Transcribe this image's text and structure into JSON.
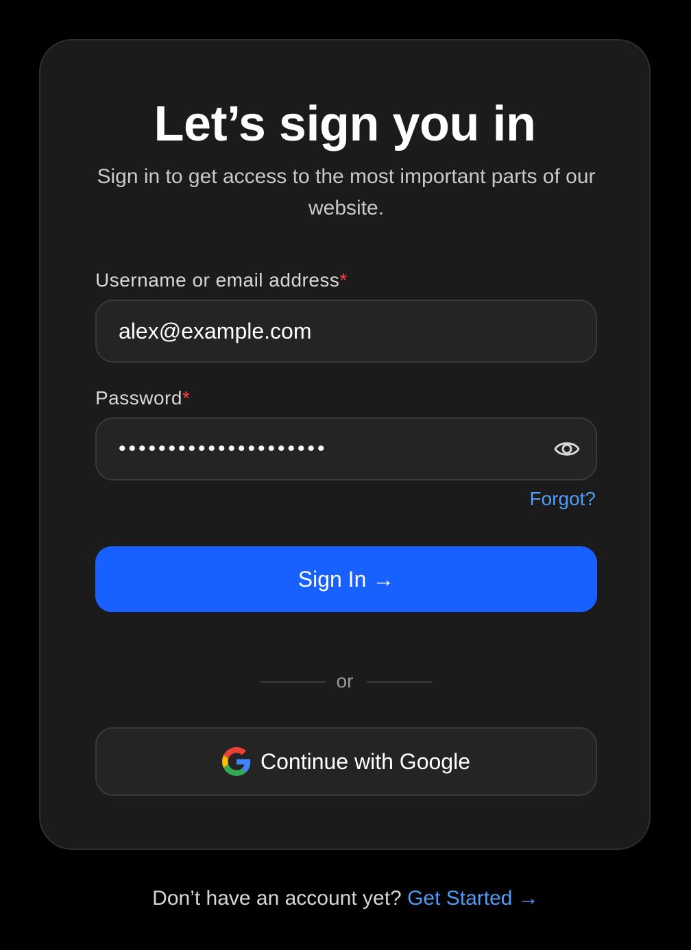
{
  "login": {
    "title": "Let’s sign you in",
    "subtitle": "Sign in to get access to the most important parts of our website.",
    "username": {
      "label": "Username or email address",
      "required_mark": "*",
      "value": "alex@example.com"
    },
    "password": {
      "label": "Password",
      "required_mark": "*",
      "value": "password-hidden-value",
      "toggle_icon": "eye-icon"
    },
    "forgot_link": "Forgot?",
    "sign_in_button": "Sign In →",
    "divider_text": "or",
    "google_button": {
      "label": "Continue with Google",
      "icon": "google-icon"
    }
  },
  "footer": {
    "prompt": "Don’t have an account yet?",
    "link": "Get Started →"
  },
  "colors": {
    "background": "#000000",
    "card": "#1b1b1b",
    "accent": "#1860ff",
    "link": "#4e9cf5",
    "required": "#ff3b3b"
  }
}
